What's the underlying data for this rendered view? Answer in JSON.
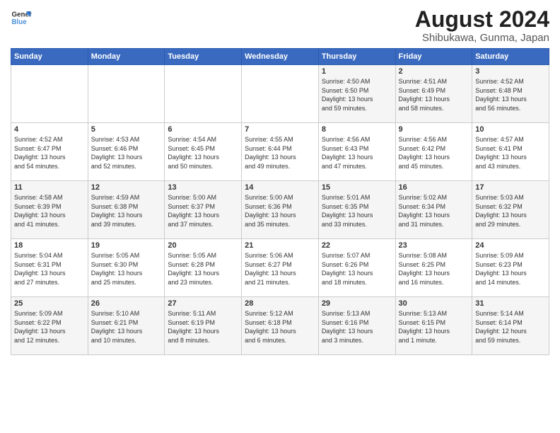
{
  "logo": {
    "line1": "General",
    "line2": "Blue"
  },
  "title": "August 2024",
  "subtitle": "Shibukawa, Gunma, Japan",
  "days_of_week": [
    "Sunday",
    "Monday",
    "Tuesday",
    "Wednesday",
    "Thursday",
    "Friday",
    "Saturday"
  ],
  "weeks": [
    [
      {
        "day": "",
        "info": ""
      },
      {
        "day": "",
        "info": ""
      },
      {
        "day": "",
        "info": ""
      },
      {
        "day": "",
        "info": ""
      },
      {
        "day": "1",
        "info": "Sunrise: 4:50 AM\nSunset: 6:50 PM\nDaylight: 13 hours\nand 59 minutes."
      },
      {
        "day": "2",
        "info": "Sunrise: 4:51 AM\nSunset: 6:49 PM\nDaylight: 13 hours\nand 58 minutes."
      },
      {
        "day": "3",
        "info": "Sunrise: 4:52 AM\nSunset: 6:48 PM\nDaylight: 13 hours\nand 56 minutes."
      }
    ],
    [
      {
        "day": "4",
        "info": "Sunrise: 4:52 AM\nSunset: 6:47 PM\nDaylight: 13 hours\nand 54 minutes."
      },
      {
        "day": "5",
        "info": "Sunrise: 4:53 AM\nSunset: 6:46 PM\nDaylight: 13 hours\nand 52 minutes."
      },
      {
        "day": "6",
        "info": "Sunrise: 4:54 AM\nSunset: 6:45 PM\nDaylight: 13 hours\nand 50 minutes."
      },
      {
        "day": "7",
        "info": "Sunrise: 4:55 AM\nSunset: 6:44 PM\nDaylight: 13 hours\nand 49 minutes."
      },
      {
        "day": "8",
        "info": "Sunrise: 4:56 AM\nSunset: 6:43 PM\nDaylight: 13 hours\nand 47 minutes."
      },
      {
        "day": "9",
        "info": "Sunrise: 4:56 AM\nSunset: 6:42 PM\nDaylight: 13 hours\nand 45 minutes."
      },
      {
        "day": "10",
        "info": "Sunrise: 4:57 AM\nSunset: 6:41 PM\nDaylight: 13 hours\nand 43 minutes."
      }
    ],
    [
      {
        "day": "11",
        "info": "Sunrise: 4:58 AM\nSunset: 6:39 PM\nDaylight: 13 hours\nand 41 minutes."
      },
      {
        "day": "12",
        "info": "Sunrise: 4:59 AM\nSunset: 6:38 PM\nDaylight: 13 hours\nand 39 minutes."
      },
      {
        "day": "13",
        "info": "Sunrise: 5:00 AM\nSunset: 6:37 PM\nDaylight: 13 hours\nand 37 minutes."
      },
      {
        "day": "14",
        "info": "Sunrise: 5:00 AM\nSunset: 6:36 PM\nDaylight: 13 hours\nand 35 minutes."
      },
      {
        "day": "15",
        "info": "Sunrise: 5:01 AM\nSunset: 6:35 PM\nDaylight: 13 hours\nand 33 minutes."
      },
      {
        "day": "16",
        "info": "Sunrise: 5:02 AM\nSunset: 6:34 PM\nDaylight: 13 hours\nand 31 minutes."
      },
      {
        "day": "17",
        "info": "Sunrise: 5:03 AM\nSunset: 6:32 PM\nDaylight: 13 hours\nand 29 minutes."
      }
    ],
    [
      {
        "day": "18",
        "info": "Sunrise: 5:04 AM\nSunset: 6:31 PM\nDaylight: 13 hours\nand 27 minutes."
      },
      {
        "day": "19",
        "info": "Sunrise: 5:05 AM\nSunset: 6:30 PM\nDaylight: 13 hours\nand 25 minutes."
      },
      {
        "day": "20",
        "info": "Sunrise: 5:05 AM\nSunset: 6:28 PM\nDaylight: 13 hours\nand 23 minutes."
      },
      {
        "day": "21",
        "info": "Sunrise: 5:06 AM\nSunset: 6:27 PM\nDaylight: 13 hours\nand 21 minutes."
      },
      {
        "day": "22",
        "info": "Sunrise: 5:07 AM\nSunset: 6:26 PM\nDaylight: 13 hours\nand 18 minutes."
      },
      {
        "day": "23",
        "info": "Sunrise: 5:08 AM\nSunset: 6:25 PM\nDaylight: 13 hours\nand 16 minutes."
      },
      {
        "day": "24",
        "info": "Sunrise: 5:09 AM\nSunset: 6:23 PM\nDaylight: 13 hours\nand 14 minutes."
      }
    ],
    [
      {
        "day": "25",
        "info": "Sunrise: 5:09 AM\nSunset: 6:22 PM\nDaylight: 13 hours\nand 12 minutes."
      },
      {
        "day": "26",
        "info": "Sunrise: 5:10 AM\nSunset: 6:21 PM\nDaylight: 13 hours\nand 10 minutes."
      },
      {
        "day": "27",
        "info": "Sunrise: 5:11 AM\nSunset: 6:19 PM\nDaylight: 13 hours\nand 8 minutes."
      },
      {
        "day": "28",
        "info": "Sunrise: 5:12 AM\nSunset: 6:18 PM\nDaylight: 13 hours\nand 6 minutes."
      },
      {
        "day": "29",
        "info": "Sunrise: 5:13 AM\nSunset: 6:16 PM\nDaylight: 13 hours\nand 3 minutes."
      },
      {
        "day": "30",
        "info": "Sunrise: 5:13 AM\nSunset: 6:15 PM\nDaylight: 13 hours\nand 1 minute."
      },
      {
        "day": "31",
        "info": "Sunrise: 5:14 AM\nSunset: 6:14 PM\nDaylight: 12 hours\nand 59 minutes."
      }
    ]
  ]
}
